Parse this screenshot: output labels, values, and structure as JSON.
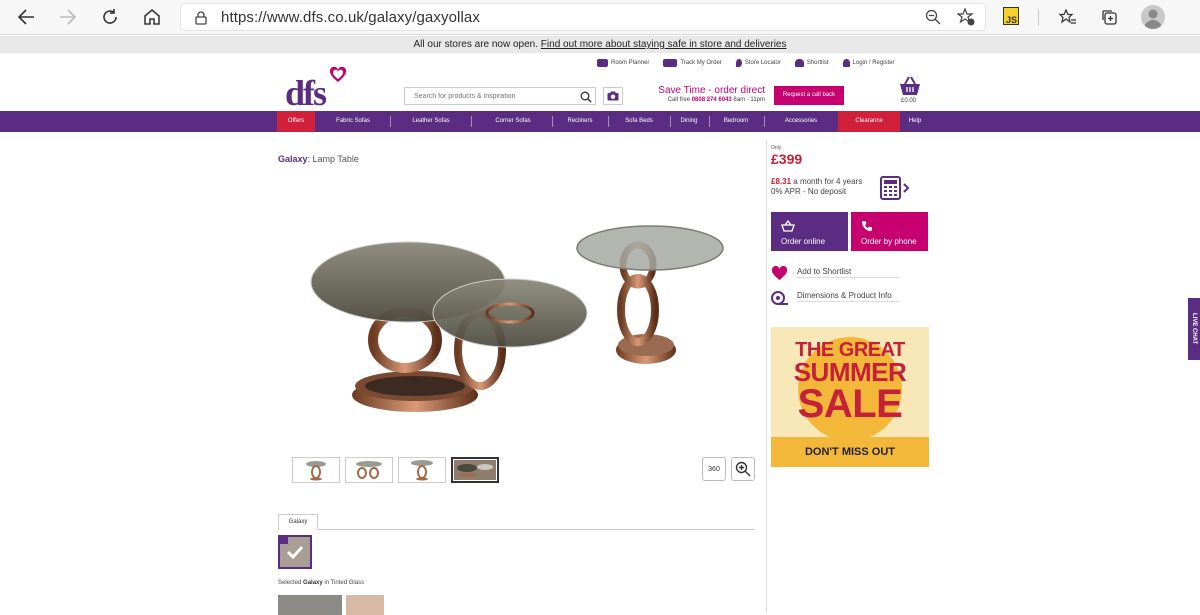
{
  "browser": {
    "url": "https://www.dfs.co.uk/galaxy/gaxyollax",
    "extension_label": "JS"
  },
  "notice": {
    "text": "All our stores are now open.",
    "link": "Find out more about staying safe in store and deliveries"
  },
  "header": {
    "util_links": [
      "Room Planner",
      "Track My Order",
      "Store Locator",
      "Shortlist",
      "Login / Register"
    ],
    "logo": "dfs",
    "search_placeholder": "Search for products & inspiration",
    "promo_title": "Save Time - order direct",
    "promo_call": "Call free",
    "promo_phone": "0808 274 6043",
    "promo_hours": "8am - 11pm",
    "callback_label": "Request a call back",
    "basket_amount": "£0.00"
  },
  "nav": {
    "items": [
      "Offers",
      "Fabric Sofas",
      "Leather Sofas",
      "Corner Sofas",
      "Recliners",
      "Sofa Beds",
      "Dining",
      "Bedroom",
      "Accessories",
      "Clearance",
      "Help"
    ]
  },
  "product": {
    "range": "Galaxy",
    "name": ": Lamp Table",
    "view360_label": "360",
    "tab_label": "Galaxy",
    "selected_prefix": "Selected",
    "selected_range": "Galaxy",
    "selected_suffix": "in Tinted Glass"
  },
  "purchase": {
    "price_prefix": "Only",
    "price": "£399",
    "monthly": "£8.31",
    "monthly_text": "a month for 4 years",
    "apr_text": "0% APR - No deposit",
    "order_online": "Order online",
    "order_phone": "Order by phone",
    "shortlist": "Add to Shortlist",
    "dimensions": "Dimensions & Product Info"
  },
  "banner": {
    "line1": "THE GREAT",
    "line2": "SUMMER",
    "line3": "SALE",
    "cta": "DON'T MISS OUT"
  },
  "live_chat": "LIVE CHAT",
  "colors": {
    "brand_purple": "#5a2d82",
    "brand_pink": "#c6006f",
    "price_red": "#c81e34",
    "sale_yellow": "#f3b83a"
  }
}
